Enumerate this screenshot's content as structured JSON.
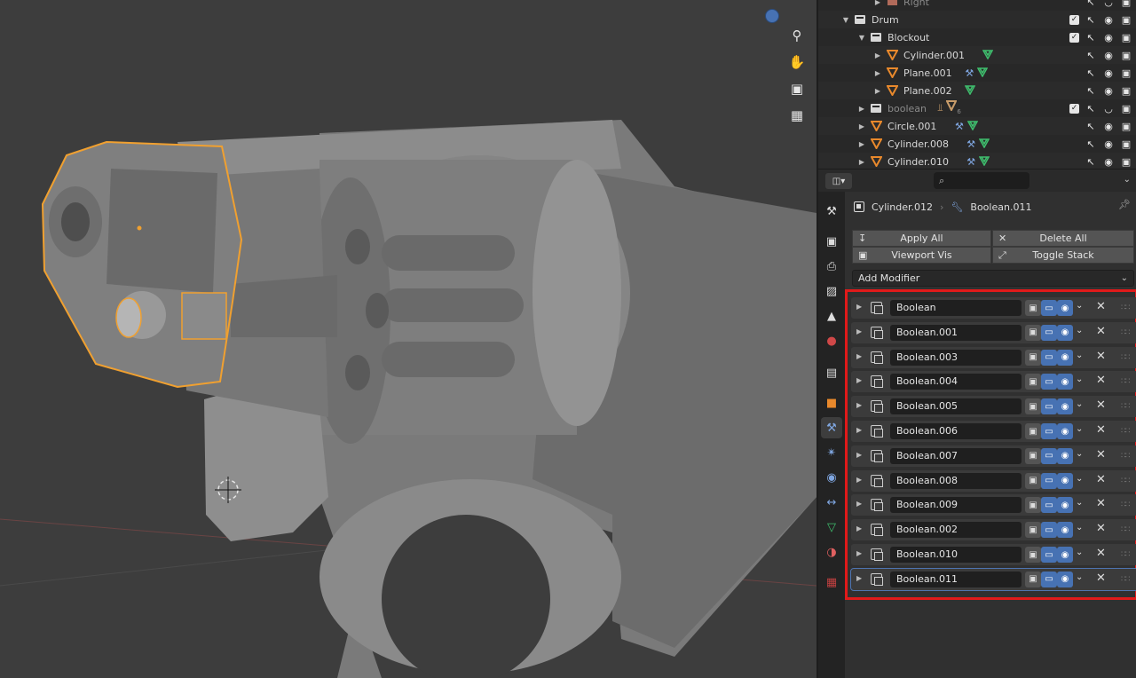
{
  "outliner": {
    "rows": [
      {
        "name": "Right",
        "indent": 3,
        "type": "camera",
        "mods": [],
        "has_check": false,
        "dim": true
      },
      {
        "name": "Drum",
        "indent": 1,
        "type": "collection",
        "mods": [],
        "has_check": true,
        "expanded": true
      },
      {
        "name": "Blockout",
        "indent": 2,
        "type": "collection",
        "mods": [],
        "has_check": true,
        "expanded": true
      },
      {
        "name": "Cylinder.001",
        "indent": 3,
        "type": "mesh",
        "mods": [
          "mesh-data-icon"
        ],
        "has_check": false
      },
      {
        "name": "Plane.001",
        "indent": 3,
        "type": "mesh",
        "mods": [
          "wrench-icon",
          "mesh-data-icon"
        ],
        "has_check": false
      },
      {
        "name": "Plane.002",
        "indent": 3,
        "type": "mesh",
        "mods": [
          "mesh-data-icon"
        ],
        "has_check": false
      },
      {
        "name": "boolean",
        "indent": 2,
        "type": "collection",
        "mods": [
          "armature-icon",
          "mesh-count-icon"
        ],
        "mesh_count": "6",
        "has_check": true,
        "dim": true
      },
      {
        "name": "Circle.001",
        "indent": 2,
        "type": "mesh",
        "mods": [
          "wrench-icon",
          "mesh-data-icon"
        ],
        "has_check": false
      },
      {
        "name": "Cylinder.008",
        "indent": 2,
        "type": "mesh",
        "mods": [
          "wrench-icon",
          "mesh-data-icon"
        ],
        "has_check": false
      },
      {
        "name": "Cylinder.010",
        "indent": 2,
        "type": "mesh",
        "mods": [
          "wrench-icon",
          "mesh-data-icon"
        ],
        "has_check": false
      }
    ]
  },
  "properties": {
    "search_placeholder": "",
    "breadcrumb": {
      "object": "Cylinder.012",
      "modifier": "Boolean.011"
    },
    "buttons": {
      "apply_all": "Apply All",
      "delete_all": "Delete All",
      "viewport_vis": "Viewport Vis",
      "toggle_stack": "Toggle Stack"
    },
    "add_modifier": "Add Modifier",
    "modifiers": [
      "Boolean",
      "Boolean.001",
      "Boolean.003",
      "Boolean.004",
      "Boolean.005",
      "Boolean.006",
      "Boolean.007",
      "Boolean.008",
      "Boolean.009",
      "Boolean.002",
      "Boolean.010",
      "Boolean.011"
    ],
    "active_modifier_index": 11,
    "tabs": [
      "tool-icon",
      "render-icon",
      "output-icon",
      "view-layer-icon",
      "scene-icon",
      "world-icon",
      "collection-icon",
      "object-icon",
      "modifier-icon",
      "particles-icon",
      "physics-icon",
      "constraints-icon",
      "object-data-icon",
      "material-icon",
      "texture-icon"
    ],
    "active_tab_index": 8
  },
  "colors": {
    "selection_outline": "#f0a030",
    "highlight_box": "#e01a1a",
    "toggle_blue": "#4772b3",
    "mesh_orange": "#e9892c",
    "data_green": "#3fbf6e",
    "wrench_blue": "#7fa6e0"
  }
}
